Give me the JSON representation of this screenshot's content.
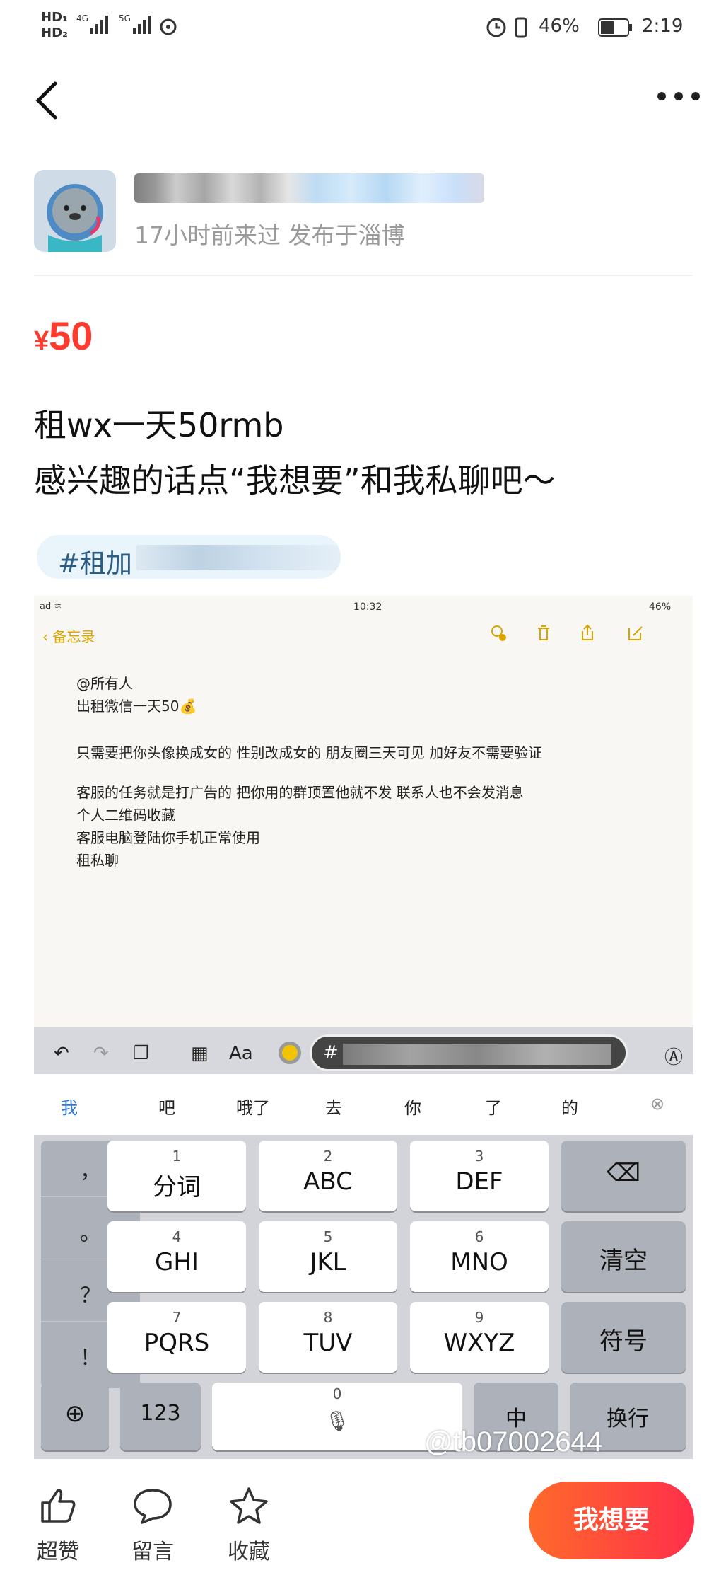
{
  "status_bar": {
    "left": "HD 4G 5G",
    "battery": "46%",
    "time": "2:19"
  },
  "listing": {
    "meta": "17小时前来过 发布于淄博",
    "price_currency": "¥",
    "price_value": "50",
    "desc_line1": "租wx一天50rmb",
    "desc_line2": "感兴趣的话点“我想要”和我私聊吧～",
    "tag": "#租加"
  },
  "screenshot": {
    "ipad_time": "10:32",
    "ipad_battery": "46%",
    "notes_back": "备忘录",
    "note_lines": [
      "@所有人",
      "出租微信一天50💰",
      "",
      "只需要把你头像换成女的 性别改成女的 朋友圈三天可见 加好友不需要验证",
      "",
      "客服的任务就是打广告的 把你用的群顶置他就不发 联系人也不会发消息",
      "个人二维码收藏",
      "客服电脑登陆你手机正常使用",
      "租私聊"
    ],
    "toolbar_aa": "Aa",
    "suggestions": [
      "我",
      "吧",
      "哦了",
      "去",
      "你",
      "了",
      "的"
    ],
    "keys": {
      "punct": [
        "，",
        "。",
        "？",
        "！"
      ],
      "k1": {
        "num": "1",
        "label": "分词"
      },
      "k2": {
        "num": "2",
        "label": "ABC"
      },
      "k3": {
        "num": "3",
        "label": "DEF"
      },
      "k4": {
        "num": "4",
        "label": "GHI"
      },
      "k5": {
        "num": "5",
        "label": "JKL"
      },
      "k6": {
        "num": "6",
        "label": "MNO"
      },
      "k7": {
        "num": "7",
        "label": "PQRS"
      },
      "k8": {
        "num": "8",
        "label": "TUV"
      },
      "k9": {
        "num": "9",
        "label": "WXYZ"
      },
      "k0": {
        "num": "0"
      },
      "clear": "清空",
      "symbols": "符号",
      "num_mode": "123",
      "lang": "中",
      "enter": "换行"
    },
    "watermark": "@tb07002644"
  },
  "bottom_bar": {
    "like": "超赞",
    "comment": "留言",
    "fav": "收藏",
    "want": "我想要"
  }
}
